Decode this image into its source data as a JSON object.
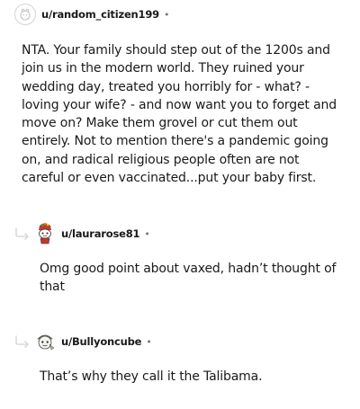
{
  "comments": [
    {
      "username": "u/random_citizen199",
      "separator": "•",
      "body": "NTA. Your family should step out of the 1200s and join us in the modern world. They ruined your wedding day, treated you horribly for - what? - loving your wife? - and now want you to forget and move on? Make them grovel or cut them out entirely. Not to mention there's a pandemic going on, and radical religious people often are not careful or even vaccinated...put your baby first."
    },
    {
      "username": "u/laurarose81",
      "separator": "•",
      "body": "Omg good point about vaxed, hadn’t thought of that"
    },
    {
      "username": "u/Bullyoncube",
      "separator": "•",
      "body": "That’s why they call it the Talibama."
    }
  ],
  "icons": {
    "default_avatar": "default-snoo-avatar-icon",
    "avatar_2": "snoo-avatar-icon",
    "avatar_3": "snoo-avatar-icon",
    "reply": "reply-arrow-icon"
  },
  "colors": {
    "text": "#1a1a1b",
    "muted": "#7c7c7c",
    "reply_arrow": "#d7dadc"
  }
}
